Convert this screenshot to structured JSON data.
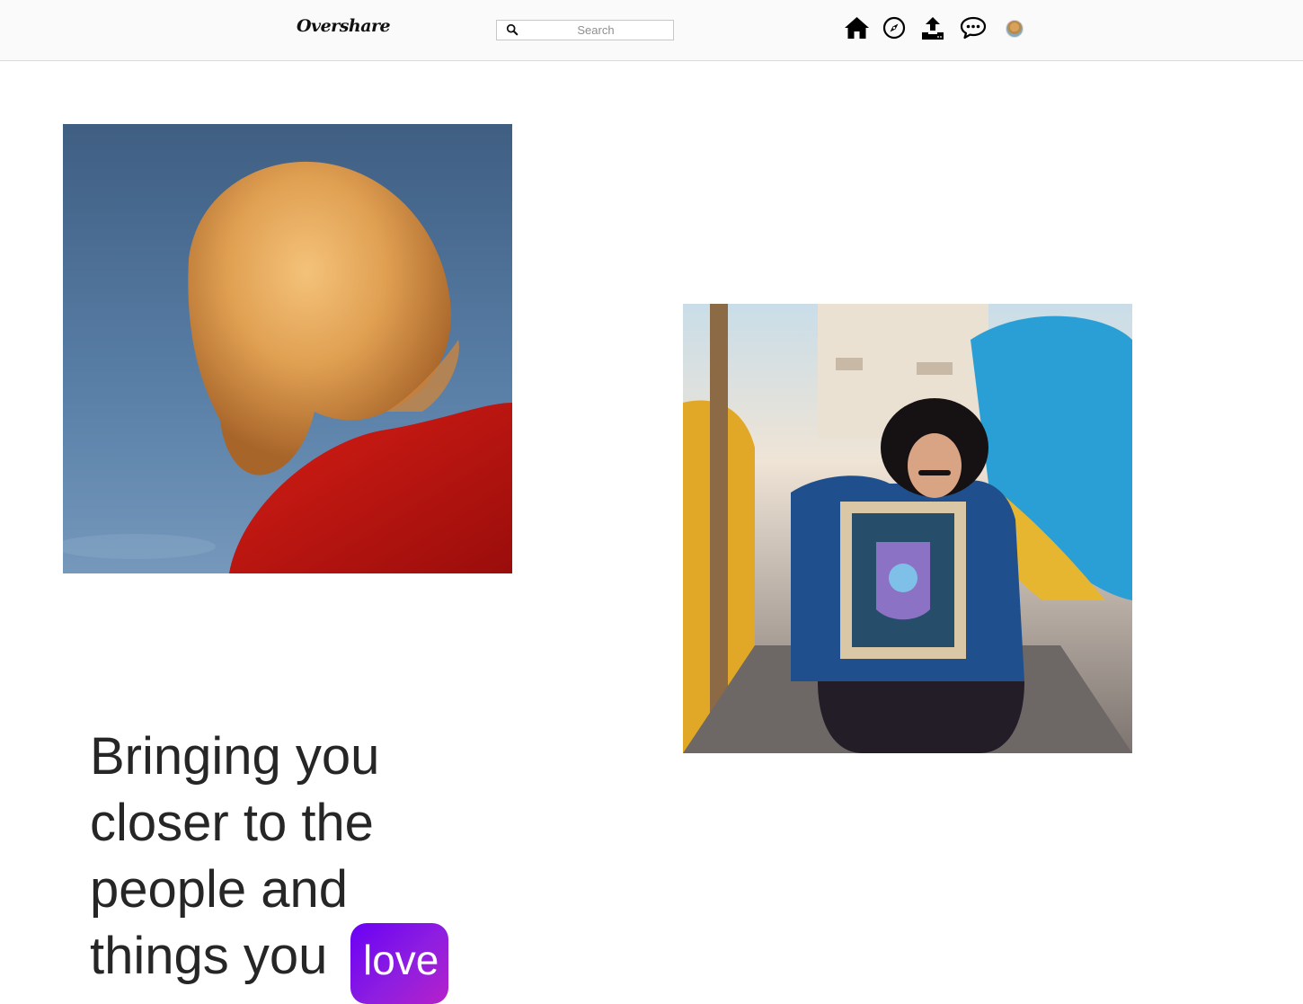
{
  "app": {
    "name": "Overshare"
  },
  "search": {
    "placeholder": "Search",
    "icon": "search-icon"
  },
  "nav": {
    "items": [
      {
        "name": "home",
        "icon": "home-icon"
      },
      {
        "name": "explore",
        "icon": "compass-icon"
      },
      {
        "name": "upload",
        "icon": "upload-icon"
      },
      {
        "name": "messages",
        "icon": "chat-icon"
      },
      {
        "name": "profile",
        "icon": "avatar"
      }
    ]
  },
  "feed": {
    "photos": [
      {
        "description": "blonde-hair-red-sweater",
        "colors": [
          "#5b80a8",
          "#e0a050",
          "#c8201e"
        ]
      },
      {
        "description": "man-holding-framed-picture",
        "colors": [
          "#2a5fa8",
          "#f0b830",
          "#3aa8d8"
        ]
      }
    ]
  },
  "hero": {
    "lines": [
      "Bringing you",
      "closer to the",
      "people and",
      "things you"
    ],
    "badge": "love",
    "badge_gradient": [
      "#6a00f4",
      "#b620c9"
    ]
  },
  "colors": {
    "topbar_bg": "#fafafa",
    "border": "#dbdbdb",
    "text": "#262626"
  }
}
